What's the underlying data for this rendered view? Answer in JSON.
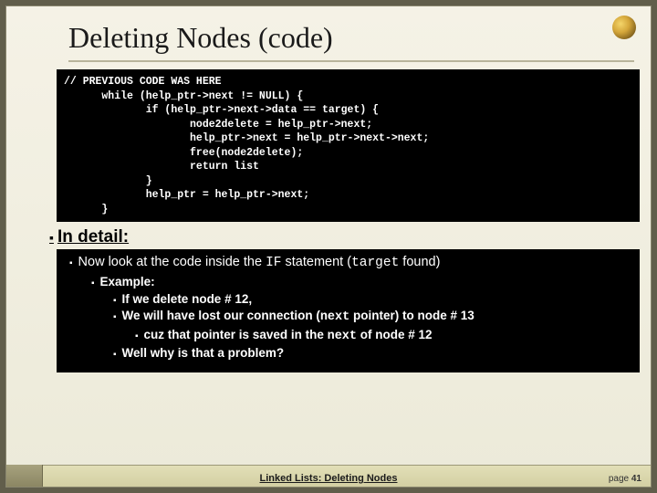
{
  "title": "Deleting Nodes (code)",
  "code": {
    "l1": "// PREVIOUS CODE WAS HERE",
    "l2": "      while (help_ptr->next != NULL) {",
    "l3": "             if (help_ptr->next->data == target) {",
    "l4": "                    node2delete = help_ptr->next;",
    "l5": "                    help_ptr->next = help_ptr->next->next;",
    "l6": "                    free(node2delete);",
    "l7": "                    return list",
    "l8": "             }",
    "l9": "             help_ptr = help_ptr->next;",
    "l10": "      }"
  },
  "detail_heading": "In detail:",
  "line1_a": "Now look at the code inside the ",
  "line1_code1": "IF",
  "line1_b": " statement (",
  "line1_code2": "target",
  "line1_c": " found)",
  "sub_example": "Example:",
  "sub_ifdelete": "If we delete node # 12,",
  "sub_lost_a": "We will have lost our connection (",
  "sub_lost_code": "next",
  "sub_lost_b": " pointer) to node # 13",
  "sub_cuz_a": "cuz that pointer is saved in the ",
  "sub_cuz_code": "next",
  "sub_cuz_b": " of node # 12",
  "sub_why": "Well why is that a problem?",
  "footer_title": "Linked Lists:  Deleting Nodes",
  "page_label": "page ",
  "page_number": "41"
}
